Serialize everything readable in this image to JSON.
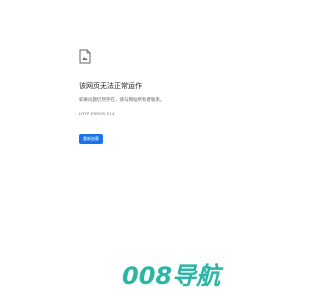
{
  "error_page": {
    "icon": "document-error-icon",
    "title": "该网页无法正常运作",
    "description": "如果问题仍然存在，请与网站所有者联系。",
    "error_code": "HTTP ERROR 514",
    "reload_label": "重新加载"
  },
  "watermark": {
    "text": "008导航"
  },
  "colors": {
    "accent": "#1a73e8",
    "watermark": "#2ab6a7",
    "background": "#ffffff"
  }
}
